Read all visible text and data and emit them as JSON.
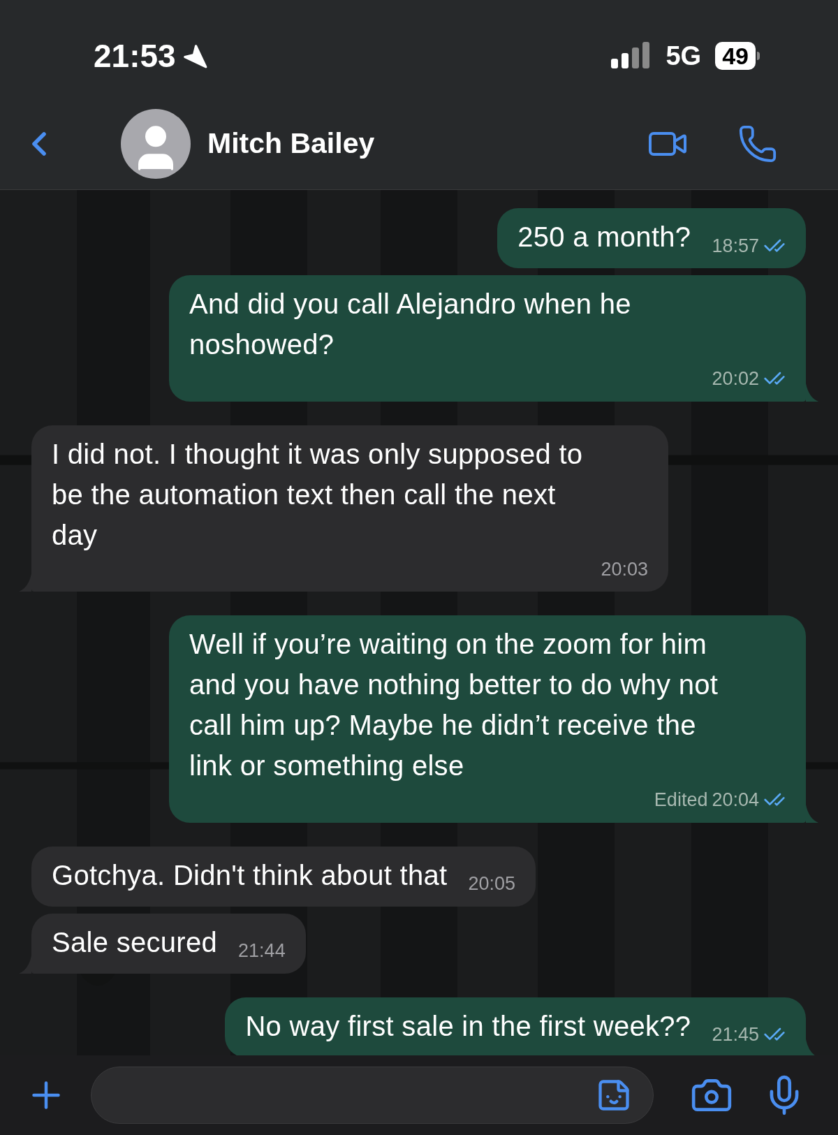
{
  "status_bar": {
    "time": "21:53",
    "network": "5G",
    "battery": "49"
  },
  "header": {
    "contact_name": "Mitch Bailey"
  },
  "messages": [
    {
      "kind": "outgoing",
      "text": "250 a month?",
      "time": "18:57",
      "read": true,
      "tail": false
    },
    {
      "kind": "outgoing",
      "text": "And did you call Alejandro when he noshowed?",
      "time": "20:02",
      "read": true,
      "tail": true
    },
    {
      "kind": "incoming",
      "text": "I did not. I thought it was only supposed to be the automation text then call the next day",
      "time": "20:03",
      "tail": true
    },
    {
      "kind": "outgoing",
      "text": "Well if you’re waiting on the zoom for him and you have nothing better to do why not call him up? Maybe he didn’t receive the link or something else",
      "edited": "Edited",
      "time": "20:04",
      "read": true,
      "tail": true
    },
    {
      "kind": "incoming",
      "text": "Gotchya. Didn't think about that",
      "time": "20:05",
      "tail": false
    },
    {
      "kind": "incoming",
      "text": "Sale secured",
      "time": "21:44",
      "tail": true
    },
    {
      "kind": "outgoing",
      "text": "No way first sale in the first week??",
      "time": "21:45",
      "read": true,
      "tail": true
    }
  ]
}
